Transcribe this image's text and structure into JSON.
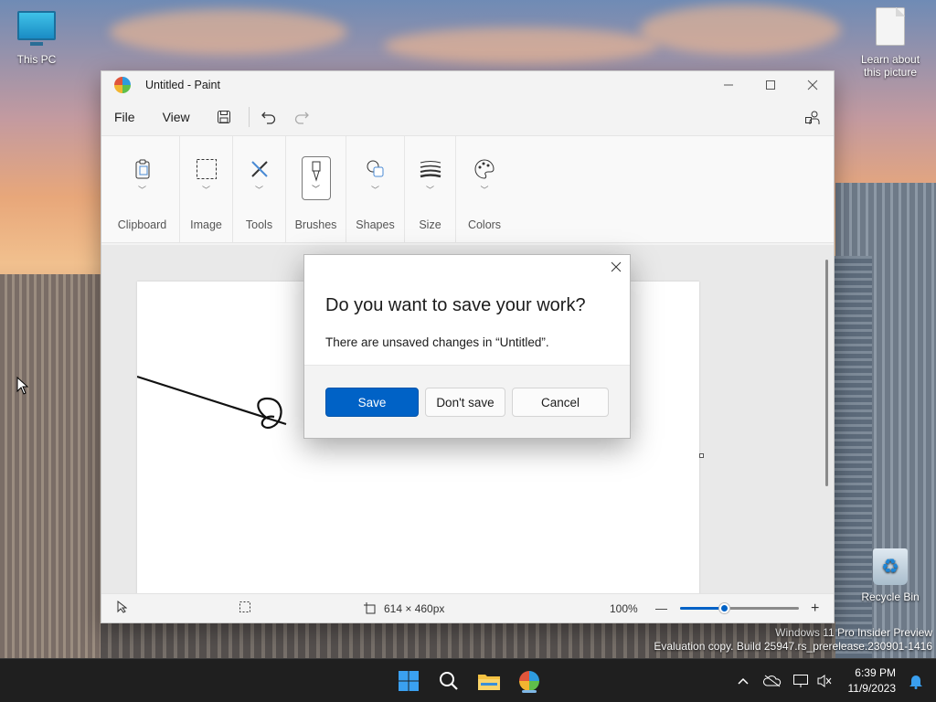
{
  "desktop": {
    "icons": [
      {
        "label": "This PC"
      },
      {
        "label": "Learn about this picture"
      },
      {
        "label": "Recycle Bin"
      }
    ],
    "watermark": {
      "line1": "Windows 11 Pro Insider Preview",
      "line2": "Evaluation copy. Build 25947.rs_prerelease.230901-1416"
    }
  },
  "window": {
    "title": "Untitled - Paint",
    "menu": {
      "file": "File",
      "view": "View"
    },
    "ribbon": [
      {
        "label": "Clipboard",
        "icon": "clipboard-icon"
      },
      {
        "label": "Image",
        "icon": "selection-icon"
      },
      {
        "label": "Tools",
        "icon": "tools-icon"
      },
      {
        "label": "Brushes",
        "icon": "brush-icon"
      },
      {
        "label": "Shapes",
        "icon": "shapes-icon"
      },
      {
        "label": "Size",
        "icon": "size-icon"
      },
      {
        "label": "Colors",
        "icon": "palette-icon"
      }
    ],
    "status": {
      "canvas_size": "614 × 460px",
      "zoom": "100%",
      "zoom_minus": "—",
      "zoom_plus": "+"
    }
  },
  "dialog": {
    "title": "Do you want to save your work?",
    "message": "There are unsaved changes in “Untitled”.",
    "save": "Save",
    "dont_save": "Don't save",
    "cancel": "Cancel"
  },
  "taskbar": {
    "time": "6:39 PM",
    "date": "11/9/2023"
  },
  "colors": {
    "accent": "#0062c6",
    "taskbar": "#1f1f1f"
  }
}
